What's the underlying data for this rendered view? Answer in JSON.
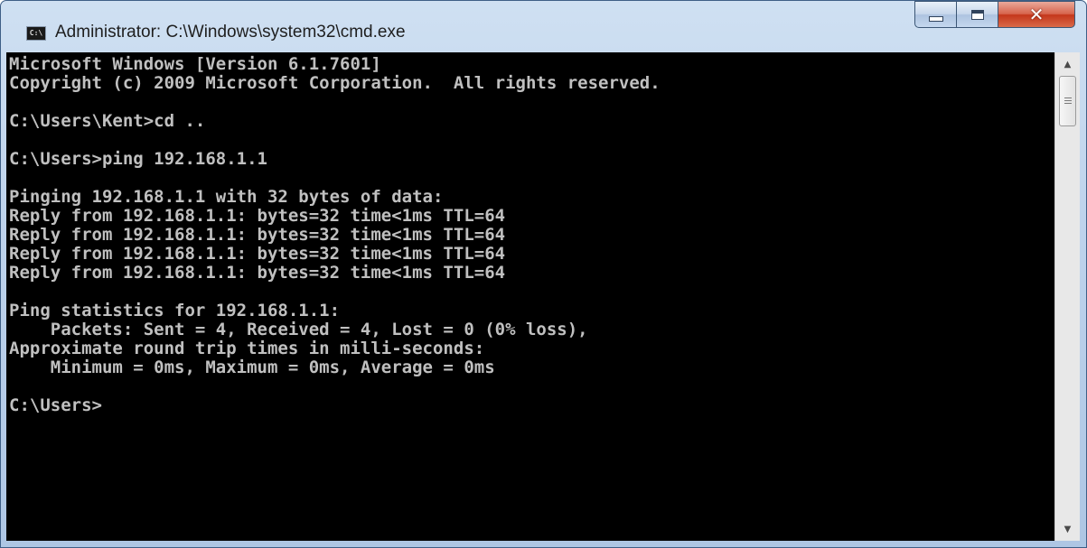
{
  "window": {
    "title": "Administrator: C:\\Windows\\system32\\cmd.exe",
    "icon_label": "C:\\",
    "icon": "cmd-icon",
    "controls": {
      "minimize_icon": "minimize-icon",
      "maximize_icon": "maximize-icon",
      "close_icon": "close-icon",
      "close_glyph": "✕"
    }
  },
  "console": {
    "background": "#000000",
    "foreground": "#c0c0c0",
    "lines": [
      "Microsoft Windows [Version 6.1.7601]",
      "Copyright (c) 2009 Microsoft Corporation.  All rights reserved.",
      "",
      "C:\\Users\\Kent>cd ..",
      "",
      "C:\\Users>ping 192.168.1.1",
      "",
      "Pinging 192.168.1.1 with 32 bytes of data:",
      "Reply from 192.168.1.1: bytes=32 time<1ms TTL=64",
      "Reply from 192.168.1.1: bytes=32 time<1ms TTL=64",
      "Reply from 192.168.1.1: bytes=32 time<1ms TTL=64",
      "Reply from 192.168.1.1: bytes=32 time<1ms TTL=64",
      "",
      "Ping statistics for 192.168.1.1:",
      "    Packets: Sent = 4, Received = 4, Lost = 0 (0% loss),",
      "Approximate round trip times in milli-seconds:",
      "    Minimum = 0ms, Maximum = 0ms, Average = 0ms",
      "",
      "C:\\Users>"
    ]
  },
  "scrollbar": {
    "up_icon": "scroll-up-arrow-icon",
    "down_icon": "scroll-down-arrow-icon",
    "up_glyph": "▲",
    "down_glyph": "▼"
  }
}
